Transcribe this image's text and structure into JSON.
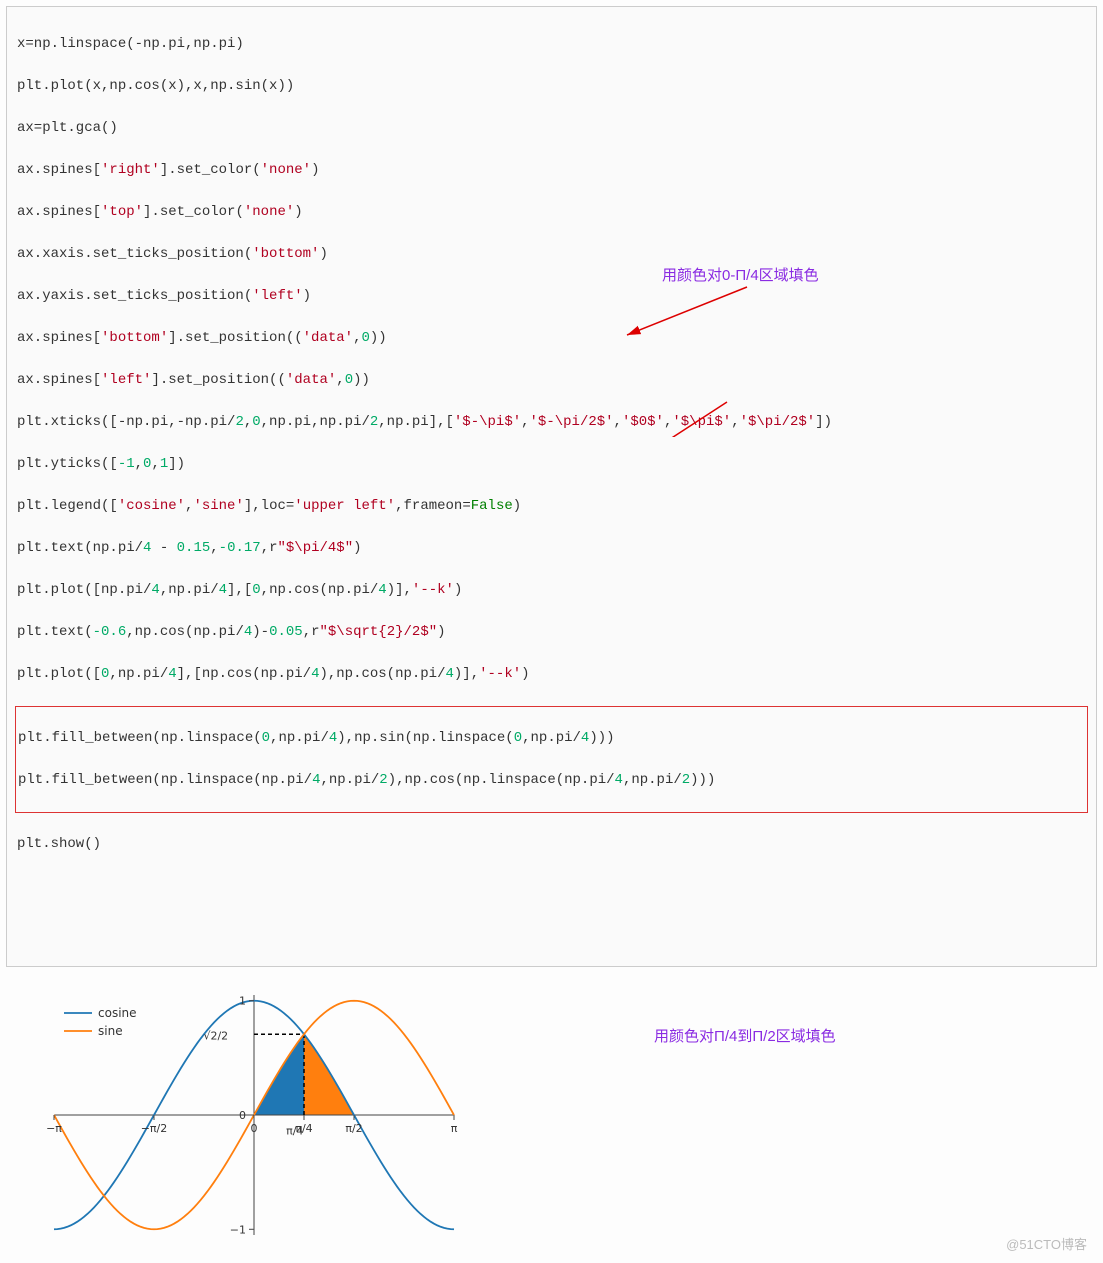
{
  "code": {
    "l01": "x=np.linspace(-np.pi,np.pi)",
    "l02": "plt.plot(x,np.cos(x),x,np.sin(x))",
    "l03": "ax=plt.gca()",
    "l04_a": "ax.spines[",
    "l04_s": "'right'",
    "l04_b": "].set_color(",
    "l04_s2": "'none'",
    "l04_c": ")",
    "l05_a": "ax.spines[",
    "l05_s": "'top'",
    "l05_b": "].set_color(",
    "l05_s2": "'none'",
    "l05_c": ")",
    "l06_a": "ax.xaxis.set_ticks_position(",
    "l06_s": "'bottom'",
    "l06_b": ")",
    "l07_a": "ax.yaxis.set_ticks_position(",
    "l07_s": "'left'",
    "l07_b": ")",
    "l08_a": "ax.spines[",
    "l08_s": "'bottom'",
    "l08_b": "].set_position((",
    "l08_s2": "'data'",
    "l08_c": ",",
    "l08_n": "0",
    "l08_d": "))",
    "l09_a": "ax.spines[",
    "l09_s": "'left'",
    "l09_b": "].set_position((",
    "l09_s2": "'data'",
    "l09_c": ",",
    "l09_n": "0",
    "l09_d": "))",
    "l10_a": "plt.xticks([-np.pi,-np.pi/",
    "l10_n1": "2",
    "l10_b": ",",
    "l10_n2": "0",
    "l10_c": ",np.pi,np.pi/",
    "l10_n3": "2",
    "l10_d": ",np.pi],[",
    "l10_s1": "'$-\\pi$'",
    "l10_e": ",",
    "l10_s2": "'$-\\pi/2$'",
    "l10_f": ",",
    "l10_s3": "'$0$'",
    "l10_g": ",",
    "l10_s4": "'$\\pi$'",
    "l10_h": ",",
    "l10_s5": "'$\\pi/2$'",
    "l10_i": "])",
    "l11_a": "plt.yticks([",
    "l11_n1": "-1",
    "l11_b": ",",
    "l11_n2": "0",
    "l11_c": ",",
    "l11_n3": "1",
    "l11_d": "])",
    "l12_a": "plt.legend([",
    "l12_s1": "'cosine'",
    "l12_b": ",",
    "l12_s2": "'sine'",
    "l12_c": "],loc=",
    "l12_s3": "'upper left'",
    "l12_d": ",frameon=",
    "l12_k": "False",
    "l12_e": ")",
    "l13_a": "plt.text(np.pi/",
    "l13_n1": "4",
    "l13_b": " - ",
    "l13_n2": "0.15",
    "l13_c": ",",
    "l13_n3": "-0.17",
    "l13_d": ",r",
    "l13_s": "\"$\\pi/4$\"",
    "l13_e": ")",
    "l14_a": "plt.plot([np.pi/",
    "l14_n1": "4",
    "l14_b": ",np.pi/",
    "l14_n2": "4",
    "l14_c": "],[",
    "l14_n3": "0",
    "l14_d": ",np.cos(np.pi/",
    "l14_n4": "4",
    "l14_e": ")],",
    "l14_s": "'--k'",
    "l14_f": ")",
    "l15_a": "plt.text(",
    "l15_n1": "-0.6",
    "l15_b": ",np.cos(np.pi/",
    "l15_n2": "4",
    "l15_c": ")-",
    "l15_n3": "0.05",
    "l15_d": ",r",
    "l15_s": "\"$\\sqrt{2}/2$\"",
    "l15_e": ")",
    "l16_a": "plt.plot([",
    "l16_n1": "0",
    "l16_b": ",np.pi/",
    "l16_n2": "4",
    "l16_c": "],[np.cos(np.pi/",
    "l16_n3": "4",
    "l16_d": "),np.cos(np.pi/",
    "l16_n4": "4",
    "l16_e": ")],",
    "l16_s": "'--k'",
    "l16_f": ")",
    "l17_a": "plt.fill_between(np.linspace(",
    "l17_n1": "0",
    "l17_b": ",np.pi/",
    "l17_n2": "4",
    "l17_c": "),np.sin(np.linspace(",
    "l17_n3": "0",
    "l17_d": ",np.pi/",
    "l17_n4": "4",
    "l17_e": ")))",
    "l18_a": "plt.fill_between(np.linspace(np.pi/",
    "l18_n1": "4",
    "l18_b": ",np.pi/",
    "l18_n2": "2",
    "l18_c": "),np.cos(np.linspace(np.pi/",
    "l18_n3": "4",
    "l18_d": ",np.pi/",
    "l18_n4": "2",
    "l18_e": ")))",
    "l19": "plt.show()"
  },
  "annotations": {
    "a1": "用颜色对0-Π/4区域填色",
    "a2": "用颜色对Π/4到Π/2区域填色"
  },
  "legend": {
    "cos": "cosine",
    "sin": "sine"
  },
  "watermark": "@51CTO博客",
  "chart_data": {
    "type": "line",
    "title": "",
    "xlabel": "",
    "ylabel": "",
    "xlim": [
      -3.1416,
      3.1416
    ],
    "ylim": [
      -1.05,
      1.05
    ],
    "xticks": [
      {
        "v": -3.1416,
        "label": "−π"
      },
      {
        "v": -1.5708,
        "label": "−π/2"
      },
      {
        "v": 0,
        "label": "0"
      },
      {
        "v": 0.7854,
        "label": "π/4"
      },
      {
        "v": 1.5708,
        "label": "π/2"
      },
      {
        "v": 3.1416,
        "label": "π"
      }
    ],
    "yticks": [
      {
        "v": -1,
        "label": "−1"
      },
      {
        "v": 0,
        "label": "0"
      },
      {
        "v": 1,
        "label": "1"
      }
    ],
    "series": [
      {
        "name": "cosine",
        "type": "cos",
        "color": "#1f77b4"
      },
      {
        "name": "sine",
        "type": "sin",
        "color": "#ff7f0e"
      }
    ],
    "fills": [
      {
        "from": 0,
        "to": 0.7854,
        "func": "sin",
        "color": "#1f77b4"
      },
      {
        "from": 0.7854,
        "to": 1.5708,
        "func": "cos",
        "color": "#ff7f0e"
      }
    ],
    "dashed_lines": [
      {
        "x1": 0.7854,
        "y1": 0,
        "x2": 0.7854,
        "y2": 0.7071
      },
      {
        "x1": 0,
        "y1": 0.7071,
        "x2": 0.7854,
        "y2": 0.7071
      }
    ],
    "labels": [
      {
        "x": 0.64,
        "y": -0.17,
        "text": "π/4"
      },
      {
        "x": -0.6,
        "y": 0.66,
        "text": "√2/2"
      }
    ],
    "legend_pos": "upper left",
    "frameon": false
  }
}
